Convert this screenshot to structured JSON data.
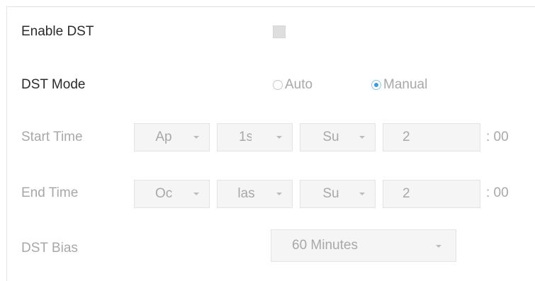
{
  "enable_dst": {
    "label": "Enable DST",
    "checked": false
  },
  "dst_mode": {
    "label": "DST Mode",
    "options": [
      {
        "label": "Auto",
        "selected": false
      },
      {
        "label": "Manual",
        "selected": true
      }
    ]
  },
  "start_time": {
    "label": "Start Time",
    "month": "Ap",
    "week": "1s",
    "day": "Su",
    "hour": "2",
    "minute_suffix": ": 00"
  },
  "end_time": {
    "label": "End Time",
    "month": "Oc",
    "week": "las",
    "day": "Su",
    "hour": "2",
    "minute_suffix": ": 00"
  },
  "dst_bias": {
    "label": "DST Bias",
    "value": "60 Minutes"
  },
  "colors": {
    "label_dark": "#2b2b2b",
    "label_muted": "#a8a8a8",
    "radio_accent": "#3b9be0",
    "field_bg": "#f5f5f5",
    "border": "#e3e3e3"
  }
}
